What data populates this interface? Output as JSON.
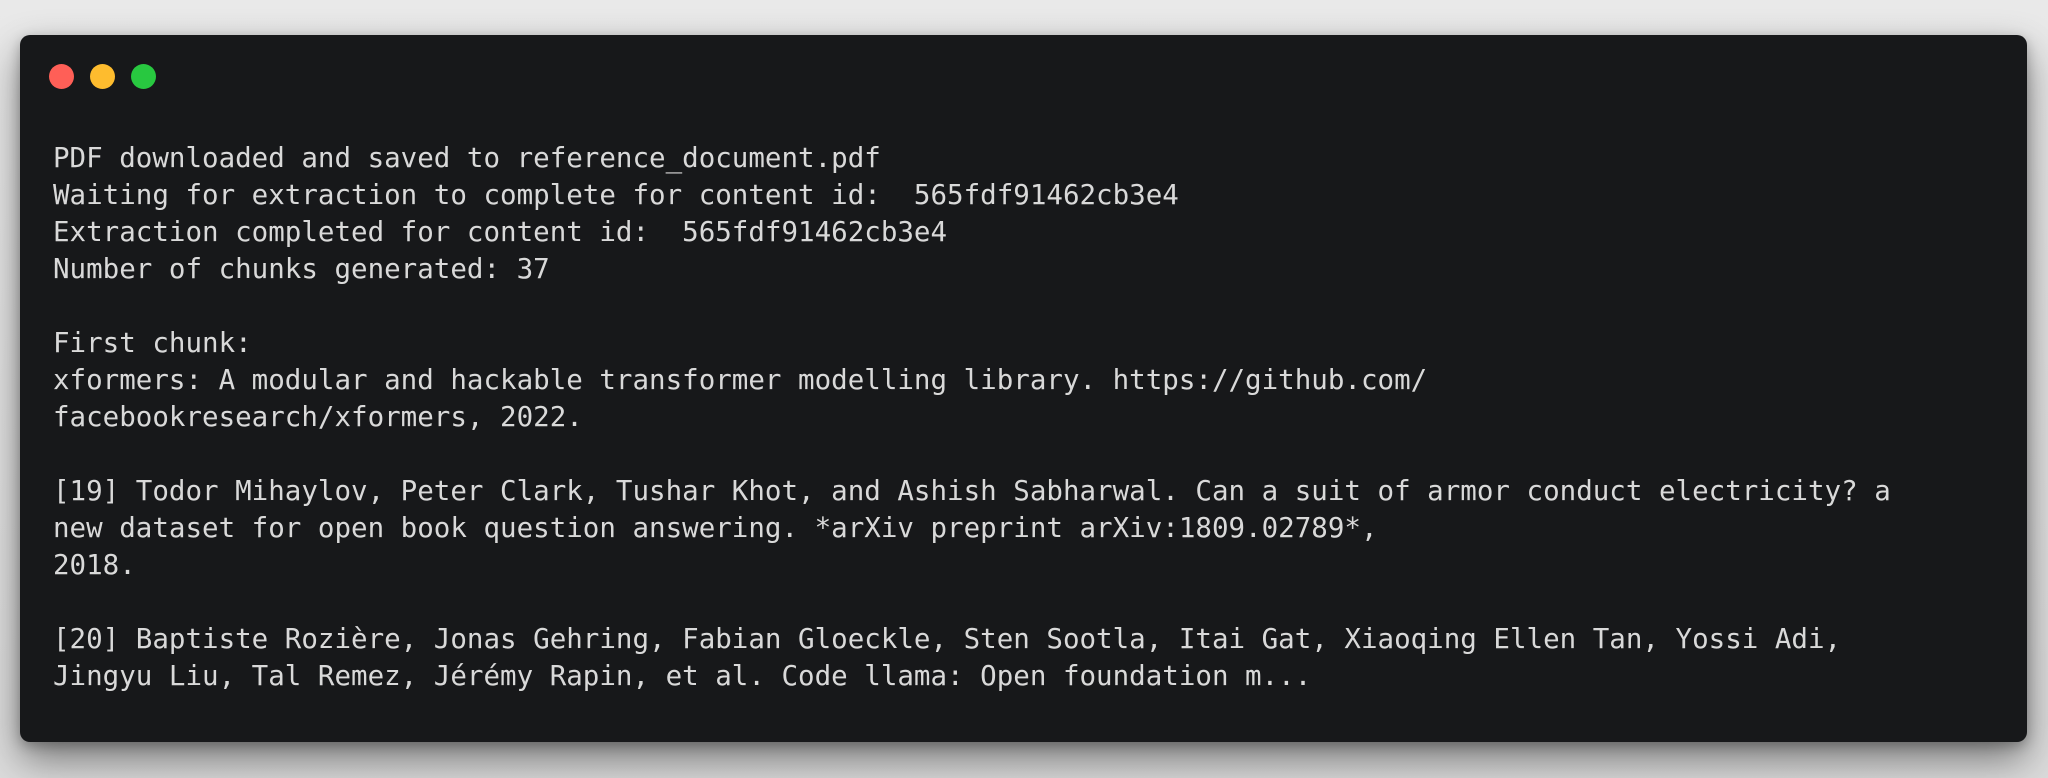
{
  "window": {
    "controls": [
      {
        "name": "close",
        "color": "#ff5f57"
      },
      {
        "name": "minimize",
        "color": "#febc2e"
      },
      {
        "name": "zoom",
        "color": "#28c840"
      }
    ]
  },
  "terminal": {
    "lines": [
      "PDF downloaded and saved to reference_document.pdf",
      "Waiting for extraction to complete for content id:  565fdf91462cb3e4",
      "Extraction completed for content id:  565fdf91462cb3e4",
      "Number of chunks generated: 37",
      "",
      "First chunk:",
      "xformers: A modular and hackable transformer modelling library. https://github.com/",
      "facebookresearch/xformers, 2022.",
      "",
      "[19] Todor Mihaylov, Peter Clark, Tushar Khot, and Ashish Sabharwal. Can a suit of armor conduct electricity? a",
      "new dataset for open book question answering. *arXiv preprint arXiv:1809.02789*,",
      "2018.",
      "",
      "[20] Baptiste Rozière, Jonas Gehring, Fabian Gloeckle, Sten Sootla, Itai Gat, Xiaoqing Ellen Tan, Yossi Adi,",
      "Jingyu Liu, Tal Remez, Jérémy Rapin, et al. Code llama: Open foundation m..."
    ]
  }
}
